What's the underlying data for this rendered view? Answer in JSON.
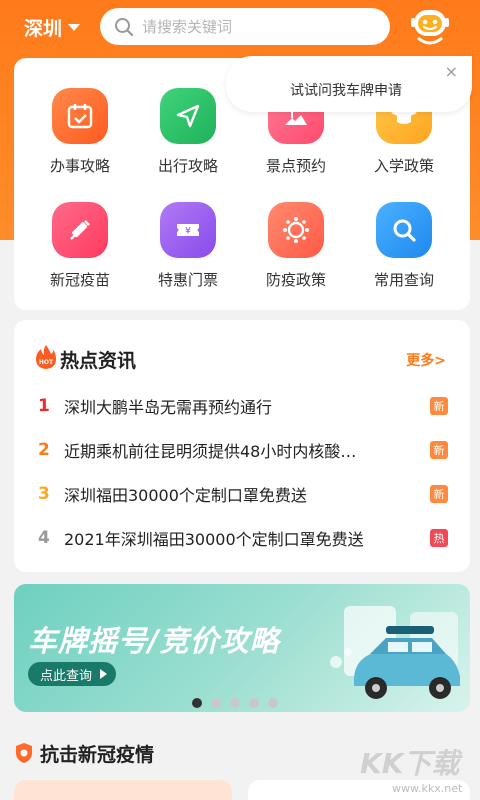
{
  "header": {
    "city": "深圳",
    "search_placeholder": "请搜索关键词"
  },
  "tooltip": {
    "text": "试试问我车牌申请",
    "close": "×"
  },
  "services": [
    {
      "label": "办事攻略",
      "icon": "calendar-check-icon",
      "color": "#ff6a2b"
    },
    {
      "label": "出行攻略",
      "icon": "send-arrow-icon",
      "color": "#2cc26a"
    },
    {
      "label": "景点预约",
      "icon": "palm-beach-icon",
      "color": "#ff5a7a"
    },
    {
      "label": "入学政策",
      "icon": "graduation-cap-icon",
      "color": "#ffb21f"
    },
    {
      "label": "新冠疫苗",
      "icon": "syringe-icon",
      "color": "#ff4a6e"
    },
    {
      "label": "特惠门票",
      "icon": "ticket-icon",
      "color": "#9b5cf0"
    },
    {
      "label": "防疫政策",
      "icon": "virus-icon",
      "color": "#ff6a55"
    },
    {
      "label": "常用查询",
      "icon": "magnifier-icon",
      "color": "#2f9bf4"
    }
  ],
  "news": {
    "title": "热点资讯",
    "more": "更多>",
    "items": [
      {
        "rank": "1",
        "text": "深圳大鹏半岛无需再预约通行",
        "badge": "新",
        "rank_color": "#ee2a2a",
        "badge_color": "#ff8a3d"
      },
      {
        "rank": "2",
        "text": "近期乘机前往昆明须提供48小时内核酸…",
        "badge": "新",
        "rank_color": "#ff7a1a",
        "badge_color": "#ff8a3d"
      },
      {
        "rank": "3",
        "text": "深圳福田30000个定制口罩免费送",
        "badge": "新",
        "rank_color": "#ffaa1a",
        "badge_color": "#ff8a3d"
      },
      {
        "rank": "4",
        "text": "2021年深圳福田30000个定制口罩免费送",
        "badge": "热",
        "rank_color": "#999999",
        "badge_color": "#f24a55"
      }
    ]
  },
  "banner": {
    "title": "车牌摇号/竞价攻略",
    "cta": "点此查询"
  },
  "carousel": {
    "count": 5,
    "active": 0
  },
  "covid": {
    "title": "抗击新冠疫情"
  },
  "watermark": {
    "main": "KK下载",
    "sub": "www.kkx.net"
  }
}
